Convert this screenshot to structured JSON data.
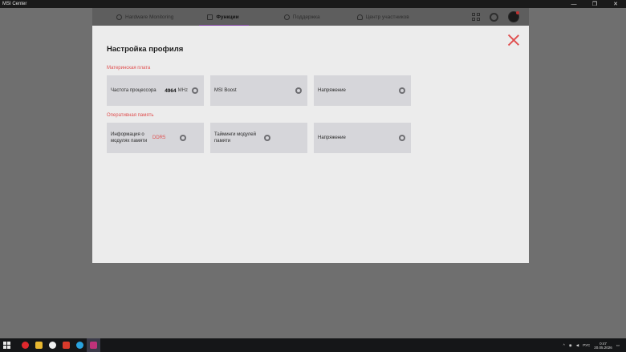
{
  "window": {
    "title": "MSI Center",
    "minimize": "—",
    "maximize": "❐",
    "close": "✕"
  },
  "nav": {
    "tabs": [
      {
        "label": "Hardware Monitoring"
      },
      {
        "label": "Функции"
      },
      {
        "label": "Поддержка"
      },
      {
        "label": "Центр участников"
      }
    ],
    "active_tab": "Функции"
  },
  "profile": {
    "title": "Настройка профиля",
    "sections": [
      {
        "label": "Материнская плата",
        "cards": [
          {
            "label": "Частота процессора",
            "value": "4964",
            "unit": "MHz"
          },
          {
            "label": "MSI Boost"
          },
          {
            "label": "Напряжение"
          }
        ]
      },
      {
        "label": "Оперативная память",
        "cards": [
          {
            "label": "Информация о модулях памяти",
            "value": "DDR5"
          },
          {
            "label": "Тайминги модулей памяти"
          },
          {
            "label": "Напряжение"
          }
        ]
      }
    ]
  },
  "taskbar": {
    "tray": {
      "chevron": "^",
      "lang": "РУС",
      "time": "0:47",
      "date": "20.05.2026"
    }
  },
  "colors": {
    "accent": "#e05050",
    "active_tab_underline": "#7d3fa0",
    "panel": "#ececec",
    "card": "#d6d6da"
  }
}
